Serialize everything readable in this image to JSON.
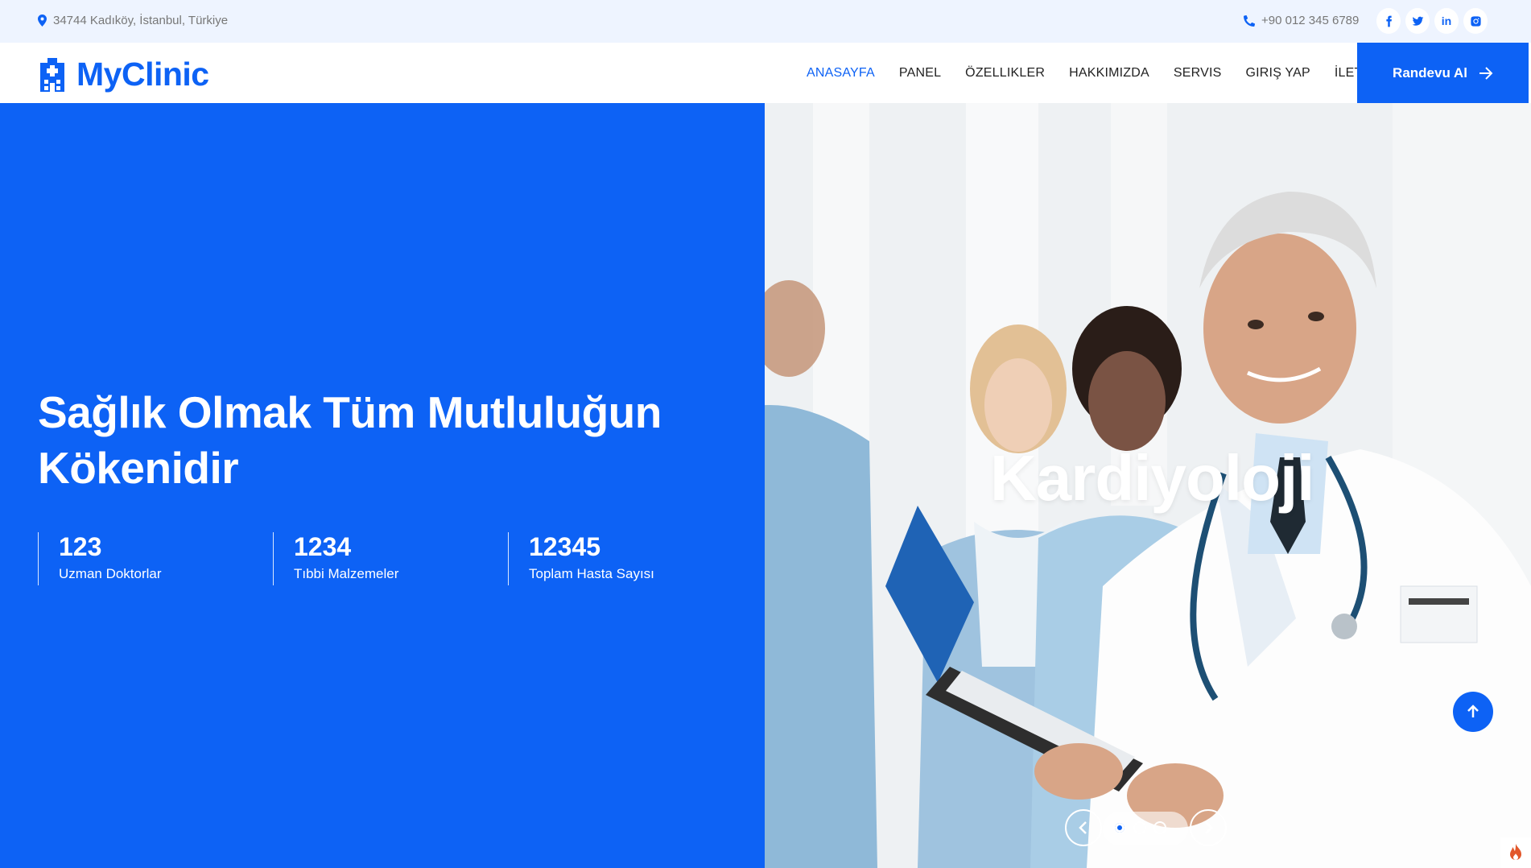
{
  "topbar": {
    "address": "34744 Kadıköy, İstanbul, Türkiye",
    "phone": "+90 012 345 6789",
    "address_icon": "map-marker-icon",
    "phone_icon": "phone-icon",
    "socials": [
      {
        "name": "facebook-icon",
        "label": "f"
      },
      {
        "name": "twitter-icon",
        "label": "t"
      },
      {
        "name": "linkedin-icon",
        "label": "in"
      },
      {
        "name": "instagram-icon",
        "label": "ig"
      }
    ]
  },
  "navbar": {
    "brand": "MyClinic",
    "brand_icon": "hospital-icon",
    "menu": [
      {
        "label": "ANASAYFA",
        "active": true
      },
      {
        "label": "PANEL",
        "active": false
      },
      {
        "label": "ÖZELLIKLER",
        "active": false
      },
      {
        "label": "HAKKIMIZDA",
        "active": false
      },
      {
        "label": "SERVIS",
        "active": false
      },
      {
        "label": "GIRIŞ YAP",
        "active": false
      },
      {
        "label": "İLETIŞIM",
        "active": false
      }
    ],
    "cta_label": "Randevu Al",
    "cta_icon": "arrow-right-icon"
  },
  "hero": {
    "headline": "Sağlık Olmak Tüm Mutluluğun Kökenidir",
    "stats": [
      {
        "value": "123",
        "label": "Uzman Doktorlar"
      },
      {
        "value": "1234",
        "label": "Tıbbi Malzemeler"
      },
      {
        "value": "12345",
        "label": "Toplam Hasta Sayısı"
      }
    ],
    "slide_title": "Kardiyoloji",
    "slide_count": 3,
    "active_slide": 1
  },
  "colors": {
    "brand": "#0d62f5",
    "topbar_bg": "#eef4ff",
    "text_dark": "#222222",
    "text_muted": "#777777"
  }
}
